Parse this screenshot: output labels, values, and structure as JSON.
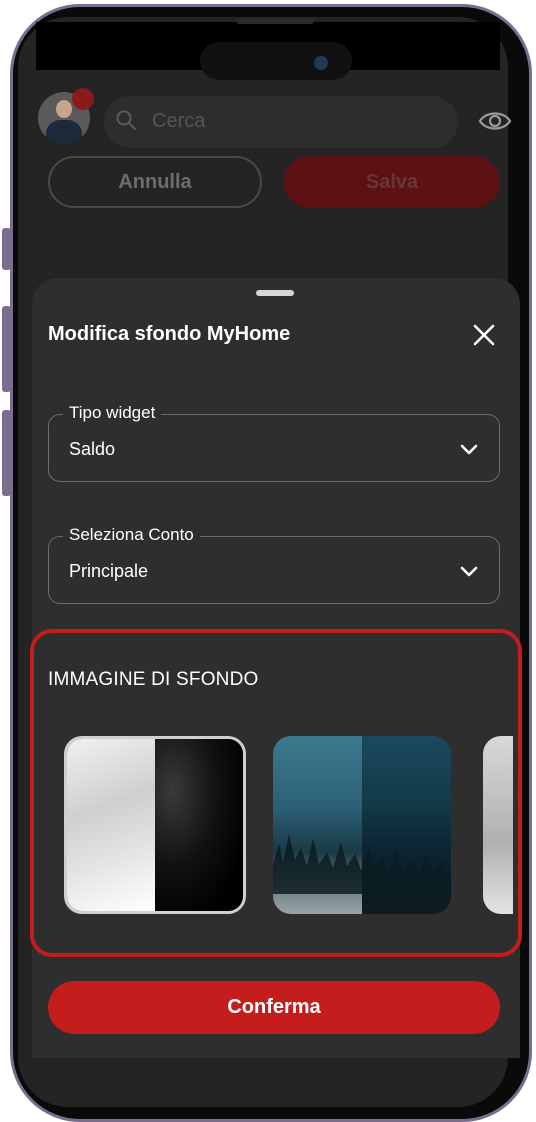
{
  "header": {
    "search_placeholder": "Cerca",
    "cancel_label": "Annulla",
    "save_label": "Salva"
  },
  "sheet": {
    "title": "Modifica sfondo MyHome",
    "widget_type": {
      "label": "Tipo widget",
      "value": "Saldo"
    },
    "account": {
      "label": "Seleziona Conto",
      "value": "Principale"
    },
    "background_section_title": "IMMAGINE DI SFONDO",
    "thumbnails": [
      "black-white-texture",
      "teal-forest",
      "grey-partial"
    ],
    "confirm_label": "Conferma"
  },
  "colors": {
    "accent_red": "#c41d1d",
    "sheet_bg": "#2e2e2e",
    "screen_bg": "#242424"
  },
  "icons": [
    "search-icon",
    "eye-icon",
    "close-icon",
    "chevron-down-icon"
  ]
}
